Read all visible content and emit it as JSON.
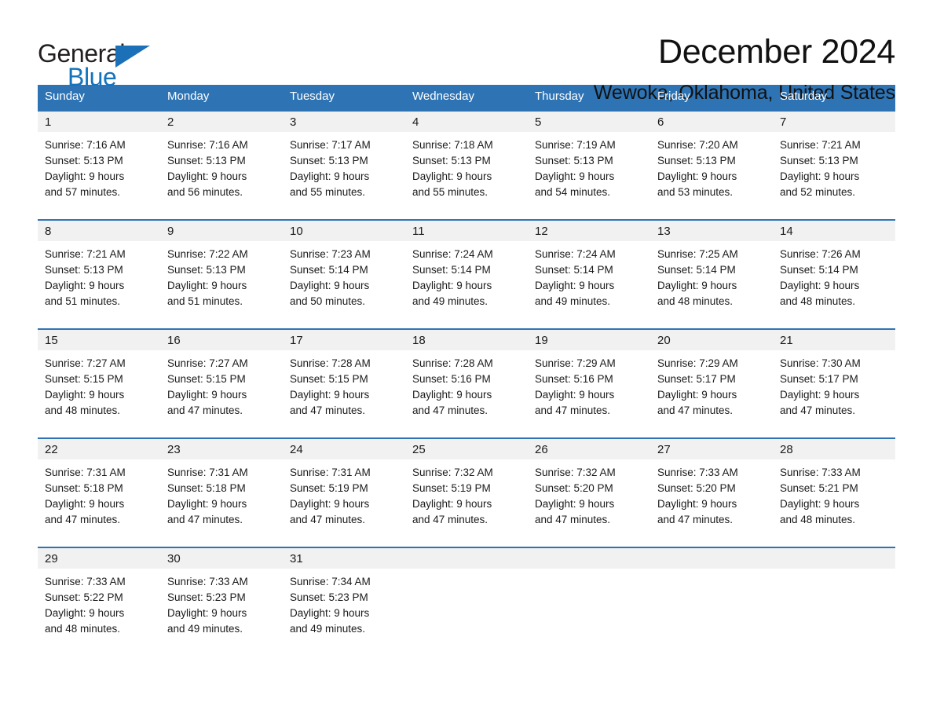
{
  "brand": {
    "name_part1": "General",
    "name_part2": "Blue",
    "accent_color": "#1473bd"
  },
  "header": {
    "title": "December 2024",
    "location": "Wewoka, Oklahoma, United States"
  },
  "calendar": {
    "header_color": "#2e74b5",
    "weekdays": [
      "Sunday",
      "Monday",
      "Tuesday",
      "Wednesday",
      "Thursday",
      "Friday",
      "Saturday"
    ],
    "weeks": [
      [
        {
          "day": "1",
          "sunrise": "Sunrise: 7:16 AM",
          "sunset": "Sunset: 5:13 PM",
          "daylight_line1": "Daylight: 9 hours",
          "daylight_line2": "and 57 minutes."
        },
        {
          "day": "2",
          "sunrise": "Sunrise: 7:16 AM",
          "sunset": "Sunset: 5:13 PM",
          "daylight_line1": "Daylight: 9 hours",
          "daylight_line2": "and 56 minutes."
        },
        {
          "day": "3",
          "sunrise": "Sunrise: 7:17 AM",
          "sunset": "Sunset: 5:13 PM",
          "daylight_line1": "Daylight: 9 hours",
          "daylight_line2": "and 55 minutes."
        },
        {
          "day": "4",
          "sunrise": "Sunrise: 7:18 AM",
          "sunset": "Sunset: 5:13 PM",
          "daylight_line1": "Daylight: 9 hours",
          "daylight_line2": "and 55 minutes."
        },
        {
          "day": "5",
          "sunrise": "Sunrise: 7:19 AM",
          "sunset": "Sunset: 5:13 PM",
          "daylight_line1": "Daylight: 9 hours",
          "daylight_line2": "and 54 minutes."
        },
        {
          "day": "6",
          "sunrise": "Sunrise: 7:20 AM",
          "sunset": "Sunset: 5:13 PM",
          "daylight_line1": "Daylight: 9 hours",
          "daylight_line2": "and 53 minutes."
        },
        {
          "day": "7",
          "sunrise": "Sunrise: 7:21 AM",
          "sunset": "Sunset: 5:13 PM",
          "daylight_line1": "Daylight: 9 hours",
          "daylight_line2": "and 52 minutes."
        }
      ],
      [
        {
          "day": "8",
          "sunrise": "Sunrise: 7:21 AM",
          "sunset": "Sunset: 5:13 PM",
          "daylight_line1": "Daylight: 9 hours",
          "daylight_line2": "and 51 minutes."
        },
        {
          "day": "9",
          "sunrise": "Sunrise: 7:22 AM",
          "sunset": "Sunset: 5:13 PM",
          "daylight_line1": "Daylight: 9 hours",
          "daylight_line2": "and 51 minutes."
        },
        {
          "day": "10",
          "sunrise": "Sunrise: 7:23 AM",
          "sunset": "Sunset: 5:14 PM",
          "daylight_line1": "Daylight: 9 hours",
          "daylight_line2": "and 50 minutes."
        },
        {
          "day": "11",
          "sunrise": "Sunrise: 7:24 AM",
          "sunset": "Sunset: 5:14 PM",
          "daylight_line1": "Daylight: 9 hours",
          "daylight_line2": "and 49 minutes."
        },
        {
          "day": "12",
          "sunrise": "Sunrise: 7:24 AM",
          "sunset": "Sunset: 5:14 PM",
          "daylight_line1": "Daylight: 9 hours",
          "daylight_line2": "and 49 minutes."
        },
        {
          "day": "13",
          "sunrise": "Sunrise: 7:25 AM",
          "sunset": "Sunset: 5:14 PM",
          "daylight_line1": "Daylight: 9 hours",
          "daylight_line2": "and 48 minutes."
        },
        {
          "day": "14",
          "sunrise": "Sunrise: 7:26 AM",
          "sunset": "Sunset: 5:14 PM",
          "daylight_line1": "Daylight: 9 hours",
          "daylight_line2": "and 48 minutes."
        }
      ],
      [
        {
          "day": "15",
          "sunrise": "Sunrise: 7:27 AM",
          "sunset": "Sunset: 5:15 PM",
          "daylight_line1": "Daylight: 9 hours",
          "daylight_line2": "and 48 minutes."
        },
        {
          "day": "16",
          "sunrise": "Sunrise: 7:27 AM",
          "sunset": "Sunset: 5:15 PM",
          "daylight_line1": "Daylight: 9 hours",
          "daylight_line2": "and 47 minutes."
        },
        {
          "day": "17",
          "sunrise": "Sunrise: 7:28 AM",
          "sunset": "Sunset: 5:15 PM",
          "daylight_line1": "Daylight: 9 hours",
          "daylight_line2": "and 47 minutes."
        },
        {
          "day": "18",
          "sunrise": "Sunrise: 7:28 AM",
          "sunset": "Sunset: 5:16 PM",
          "daylight_line1": "Daylight: 9 hours",
          "daylight_line2": "and 47 minutes."
        },
        {
          "day": "19",
          "sunrise": "Sunrise: 7:29 AM",
          "sunset": "Sunset: 5:16 PM",
          "daylight_line1": "Daylight: 9 hours",
          "daylight_line2": "and 47 minutes."
        },
        {
          "day": "20",
          "sunrise": "Sunrise: 7:29 AM",
          "sunset": "Sunset: 5:17 PM",
          "daylight_line1": "Daylight: 9 hours",
          "daylight_line2": "and 47 minutes."
        },
        {
          "day": "21",
          "sunrise": "Sunrise: 7:30 AM",
          "sunset": "Sunset: 5:17 PM",
          "daylight_line1": "Daylight: 9 hours",
          "daylight_line2": "and 47 minutes."
        }
      ],
      [
        {
          "day": "22",
          "sunrise": "Sunrise: 7:31 AM",
          "sunset": "Sunset: 5:18 PM",
          "daylight_line1": "Daylight: 9 hours",
          "daylight_line2": "and 47 minutes."
        },
        {
          "day": "23",
          "sunrise": "Sunrise: 7:31 AM",
          "sunset": "Sunset: 5:18 PM",
          "daylight_line1": "Daylight: 9 hours",
          "daylight_line2": "and 47 minutes."
        },
        {
          "day": "24",
          "sunrise": "Sunrise: 7:31 AM",
          "sunset": "Sunset: 5:19 PM",
          "daylight_line1": "Daylight: 9 hours",
          "daylight_line2": "and 47 minutes."
        },
        {
          "day": "25",
          "sunrise": "Sunrise: 7:32 AM",
          "sunset": "Sunset: 5:19 PM",
          "daylight_line1": "Daylight: 9 hours",
          "daylight_line2": "and 47 minutes."
        },
        {
          "day": "26",
          "sunrise": "Sunrise: 7:32 AM",
          "sunset": "Sunset: 5:20 PM",
          "daylight_line1": "Daylight: 9 hours",
          "daylight_line2": "and 47 minutes."
        },
        {
          "day": "27",
          "sunrise": "Sunrise: 7:33 AM",
          "sunset": "Sunset: 5:20 PM",
          "daylight_line1": "Daylight: 9 hours",
          "daylight_line2": "and 47 minutes."
        },
        {
          "day": "28",
          "sunrise": "Sunrise: 7:33 AM",
          "sunset": "Sunset: 5:21 PM",
          "daylight_line1": "Daylight: 9 hours",
          "daylight_line2": "and 48 minutes."
        }
      ],
      [
        {
          "day": "29",
          "sunrise": "Sunrise: 7:33 AM",
          "sunset": "Sunset: 5:22 PM",
          "daylight_line1": "Daylight: 9 hours",
          "daylight_line2": "and 48 minutes."
        },
        {
          "day": "30",
          "sunrise": "Sunrise: 7:33 AM",
          "sunset": "Sunset: 5:23 PM",
          "daylight_line1": "Daylight: 9 hours",
          "daylight_line2": "and 49 minutes."
        },
        {
          "day": "31",
          "sunrise": "Sunrise: 7:34 AM",
          "sunset": "Sunset: 5:23 PM",
          "daylight_line1": "Daylight: 9 hours",
          "daylight_line2": "and 49 minutes."
        },
        {
          "day": "",
          "sunrise": "",
          "sunset": "",
          "daylight_line1": "",
          "daylight_line2": ""
        },
        {
          "day": "",
          "sunrise": "",
          "sunset": "",
          "daylight_line1": "",
          "daylight_line2": ""
        },
        {
          "day": "",
          "sunrise": "",
          "sunset": "",
          "daylight_line1": "",
          "daylight_line2": ""
        },
        {
          "day": "",
          "sunrise": "",
          "sunset": "",
          "daylight_line1": "",
          "daylight_line2": ""
        }
      ]
    ]
  }
}
